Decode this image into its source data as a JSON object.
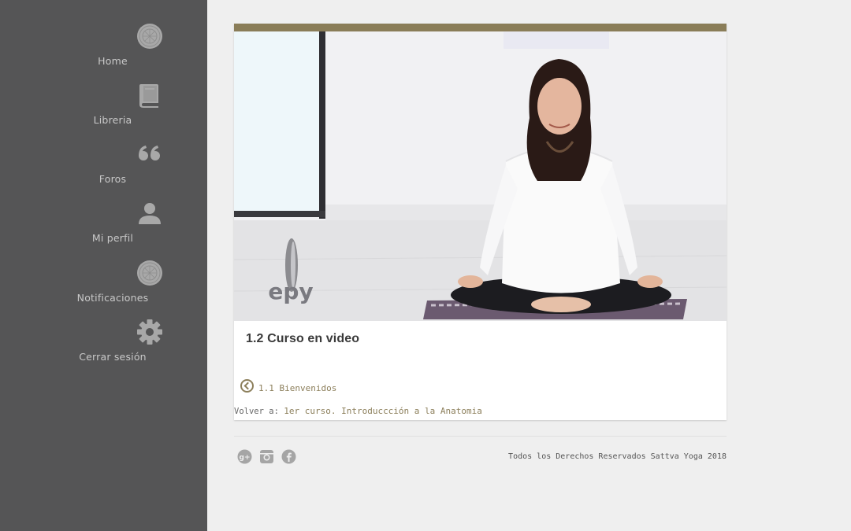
{
  "colors": {
    "sidebar_bg": "#555556",
    "accent": "#8c7f5b",
    "card_topbar": "#8a7d58",
    "nav_text": "#c8c8c8"
  },
  "sidebar": {
    "items": [
      {
        "label": "Home",
        "icon": "emblem-icon"
      },
      {
        "label": "Libreria",
        "icon": "book-icon"
      },
      {
        "label": "Foros",
        "icon": "quote-icon"
      },
      {
        "label": "Mi perfil",
        "icon": "user-icon"
      },
      {
        "label": "Notificaciones",
        "icon": "emblem-icon"
      },
      {
        "label": "Cerrar sesión",
        "icon": "gear-icon"
      }
    ]
  },
  "lesson": {
    "video_watermark": "epy",
    "title": "1.2 Curso en video",
    "prev_label": "1.1 Bienvenidos",
    "back_prefix": "Volver a:",
    "back_link": "1er curso. Introduccción a la Anatomia"
  },
  "footer": {
    "social": [
      "google-plus-icon",
      "instagram-icon",
      "facebook-icon"
    ],
    "copyright": "Todos los Derechos Reservados Sattva Yoga 2018"
  }
}
